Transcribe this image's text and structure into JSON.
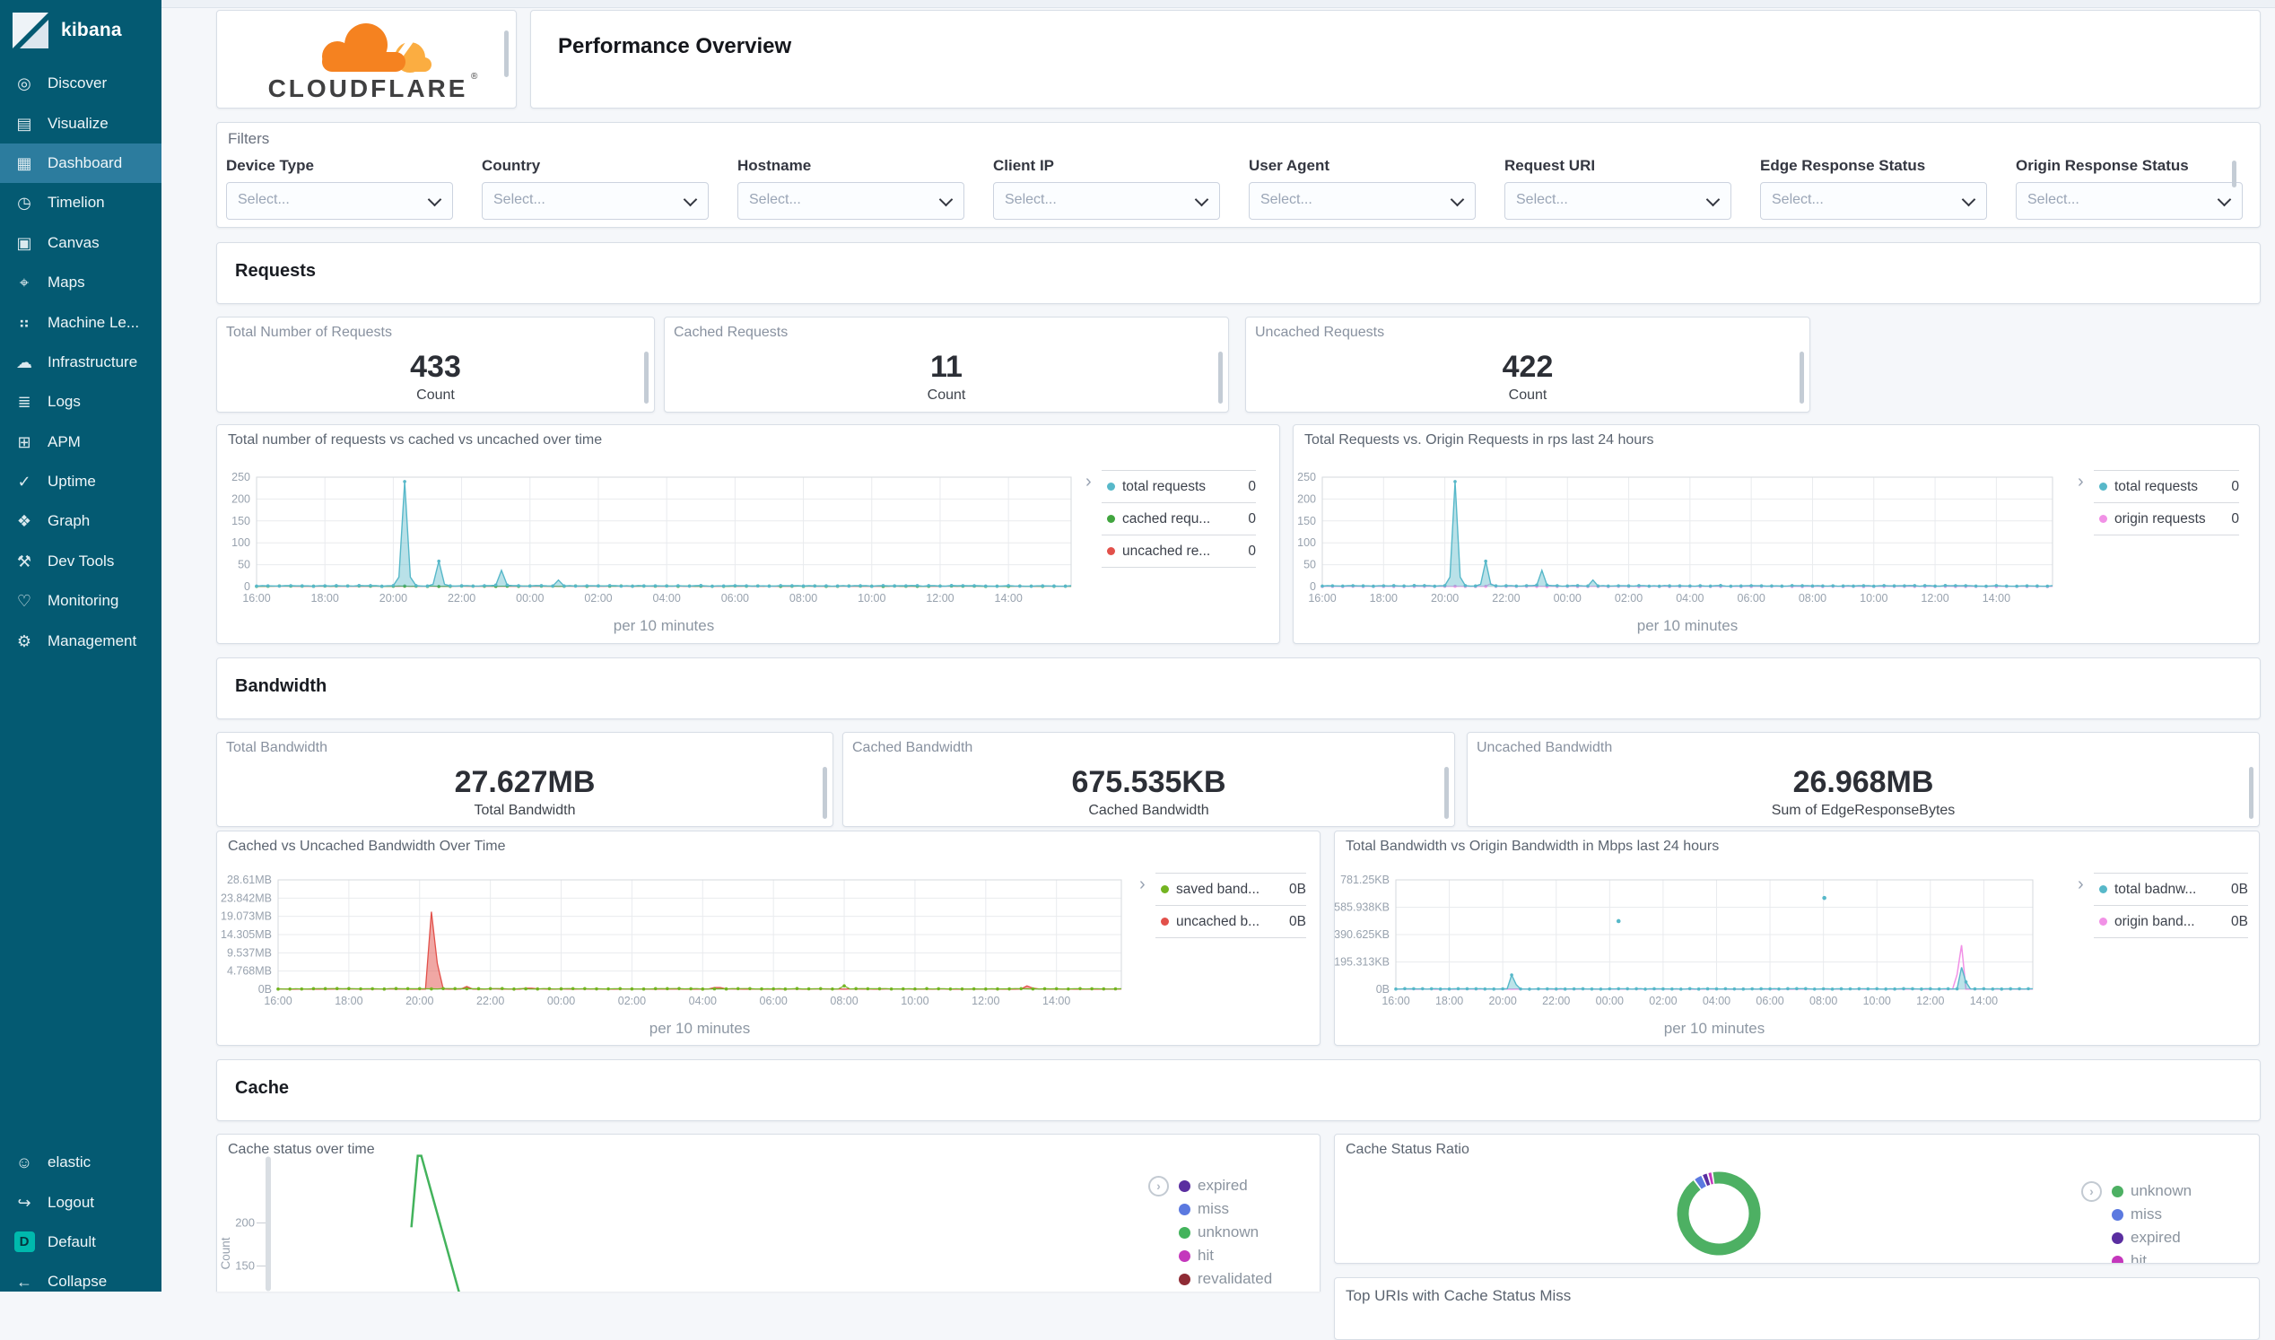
{
  "sidebar": {
    "logo_text": "kibana",
    "items": [
      {
        "label": "Discover",
        "icon": "◎"
      },
      {
        "label": "Visualize",
        "icon": "▤"
      },
      {
        "label": "Dashboard",
        "icon": "▦"
      },
      {
        "label": "Timelion",
        "icon": "◷"
      },
      {
        "label": "Canvas",
        "icon": "▣"
      },
      {
        "label": "Maps",
        "icon": "⌖"
      },
      {
        "label": "Machine Le...",
        "icon": "⠶"
      },
      {
        "label": "Infrastructure",
        "icon": "☁"
      },
      {
        "label": "Logs",
        "icon": "≣"
      },
      {
        "label": "APM",
        "icon": "⊞"
      },
      {
        "label": "Uptime",
        "icon": "✓"
      },
      {
        "label": "Graph",
        "icon": "❖"
      },
      {
        "label": "Dev Tools",
        "icon": "⚒"
      },
      {
        "label": "Monitoring",
        "icon": "♡"
      },
      {
        "label": "Management",
        "icon": "⚙"
      }
    ],
    "footer_items": [
      {
        "label": "elastic",
        "icon": "☺"
      },
      {
        "label": "Logout",
        "icon": "↪"
      },
      {
        "label": "Default",
        "icon": "D"
      },
      {
        "label": "Collapse",
        "icon": "←"
      }
    ]
  },
  "header": {
    "brand": "CLOUDFLARE",
    "registered": "®",
    "title": "Performance Overview"
  },
  "filters": {
    "title": "Filters",
    "placeholder": "Select...",
    "fields": [
      "Device Type",
      "Country",
      "Hostname",
      "Client IP",
      "User Agent",
      "Request URI",
      "Edge Response Status",
      "Origin Response Status"
    ]
  },
  "sections": {
    "requests": "Requests",
    "bandwidth": "Bandwidth",
    "cache": "Cache"
  },
  "metrics": {
    "requests": [
      {
        "label": "Total Number of Requests",
        "value": "433",
        "unit": "Count"
      },
      {
        "label": "Cached Requests",
        "value": "11",
        "unit": "Count"
      },
      {
        "label": "Uncached Requests",
        "value": "422",
        "unit": "Count"
      }
    ],
    "bandwidth": [
      {
        "label": "Total Bandwidth",
        "value": "27.627MB",
        "unit": "Total Bandwidth"
      },
      {
        "label": "Cached Bandwidth",
        "value": "675.535KB",
        "unit": "Cached Bandwidth"
      },
      {
        "label": "Uncached Bandwidth",
        "value": "26.968MB",
        "unit": "Sum of EdgeResponseBytes"
      }
    ]
  },
  "panels": {
    "top_uris_title": "Top URIs with Cache Status Miss"
  },
  "colors": {
    "sidebar_bg": "#045a72",
    "sidebar_active": "#2c7c9e",
    "accent_teal": "#00c2b2",
    "cloudflare_orange": "#f58220",
    "cloudflare_orange_light": "#fbad41",
    "series_teal": "#57b8c9",
    "series_green": "#41a53f",
    "series_red": "#e2504a",
    "series_pink": "#f191e6",
    "series_lime": "#73b421"
  },
  "chart_data": [
    {
      "type": "area",
      "title": "Total number of requests vs cached vs uncached over time",
      "x_label": "per 10 minutes",
      "x_ticks": [
        "16:00",
        "18:00",
        "20:00",
        "22:00",
        "00:00",
        "02:00",
        "04:00",
        "06:00",
        "08:00",
        "10:00",
        "12:00",
        "14:00"
      ],
      "y_ticks": [
        "250",
        "200",
        "150",
        "100",
        "50",
        "0"
      ],
      "y_max": 250,
      "series": [
        {
          "name": "total requests",
          "value": "0",
          "color": "#57b8c9",
          "fill": 0.42,
          "baseline": 2.2,
          "spikes": [
            [
              260,
              240
            ],
            [
              320,
              58
            ],
            [
              430,
              37
            ],
            [
              530,
              15
            ]
          ],
          "dots": true,
          "seed": 1
        },
        {
          "name": "cached requ...",
          "value": "0",
          "color": "#41a53f",
          "baseline": 1.4,
          "dots": true,
          "seed": 2,
          "width": 1
        },
        {
          "name": "uncached re...",
          "value": "0",
          "color": "#e2504a",
          "baseline": 0.9,
          "seed": 3,
          "width": 1
        }
      ]
    },
    {
      "type": "area",
      "title": "Total Requests vs. Origin Requests in rps last 24 hours",
      "x_label": "per 10 minutes",
      "x_ticks": [
        "16:00",
        "18:00",
        "20:00",
        "22:00",
        "00:00",
        "02:00",
        "04:00",
        "06:00",
        "08:00",
        "10:00",
        "12:00",
        "14:00"
      ],
      "y_ticks": [
        "250",
        "200",
        "150",
        "100",
        "50",
        "0"
      ],
      "y_max": 250,
      "series": [
        {
          "name": "total requests",
          "value": "0",
          "color": "#57b8c9",
          "fill": 0.42,
          "baseline": 2.2,
          "spikes": [
            [
              260,
              240
            ],
            [
              320,
              58
            ],
            [
              430,
              37
            ],
            [
              530,
              15
            ]
          ],
          "dots": true,
          "seed": 1
        },
        {
          "name": "origin requests",
          "value": "0",
          "color": "#f191e6",
          "baseline": 0.7,
          "spikes": [
            [
              330,
              7
            ]
          ],
          "dots": true,
          "seed": 4,
          "width": 1
        }
      ]
    },
    {
      "type": "area",
      "title": "Cached vs Uncached Bandwidth Over Time",
      "x_label": "per 10 minutes",
      "x_ticks": [
        "16:00",
        "18:00",
        "20:00",
        "22:00",
        "00:00",
        "02:00",
        "04:00",
        "06:00",
        "08:00",
        "10:00",
        "12:00",
        "14:00"
      ],
      "y_ticks": [
        "28.61MB",
        "23.842MB",
        "19.073MB",
        "14.305MB",
        "9.537MB",
        "4.768MB",
        "0B"
      ],
      "y_max": 28.61,
      "series": [
        {
          "name": "saved band...",
          "value": "0B",
          "color": "#73b421",
          "baseline": 0.18,
          "spikes": [
            [
              960,
              0.9
            ]
          ],
          "dots": true,
          "seed": 5,
          "width": 1.2
        },
        {
          "name": "uncached b...",
          "value": "0B",
          "color": "#e2504a",
          "fill": 0.5,
          "baseline": 0.1,
          "spikes": [
            [
              262,
              24.8
            ],
            [
              320,
              0.75
            ],
            [
              425,
              0.5
            ],
            [
              745,
              0.85
            ],
            [
              1272,
              1.1
            ]
          ],
          "seed": 6,
          "width": 1.3
        }
      ]
    },
    {
      "type": "area",
      "title": "Total Bandwidth vs Origin Bandwidth in Mbps last 24 hours",
      "x_label": "per 10 minutes",
      "x_ticks": [
        "16:00",
        "18:00",
        "20:00",
        "22:00",
        "00:00",
        "02:00",
        "04:00",
        "06:00",
        "08:00",
        "10:00",
        "12:00",
        "14:00"
      ],
      "y_ticks": [
        "781.25KB",
        "585.938KB",
        "390.625KB",
        "195.313KB",
        "0B"
      ],
      "y_max": 781.25,
      "series": [
        {
          "name": "total badnw...",
          "value": "0B",
          "color": "#57b8c9",
          "fill": 0.4,
          "baseline": 4,
          "spikes": [
            [
              262,
              125
            ],
            [
              1272,
              192
            ]
          ],
          "dots": true,
          "dots_extra": [
            [
              500,
              487
            ],
            [
              962,
              652
            ]
          ],
          "seed": 7
        },
        {
          "name": "origin band...",
          "value": "0B",
          "color": "#f191e6",
          "baseline": 2,
          "spikes": [
            [
              1268,
              385
            ]
          ],
          "seed": 8,
          "width": 1.5
        }
      ]
    },
    {
      "type": "line",
      "title": "Cache status over time",
      "y_label": "Count",
      "visible_y_ticks": [
        "200",
        "150"
      ],
      "series": [
        {
          "name": "expired",
          "color": "#5a2ea0"
        },
        {
          "name": "miss",
          "color": "#5b79e0"
        },
        {
          "name": "unknown",
          "color": "#43b35c"
        },
        {
          "name": "hit",
          "color": "#c437bc"
        },
        {
          "name": "revalidated",
          "color": "#8f2b35"
        }
      ],
      "unknown_spike_points": [
        [
          200,
          195
        ],
        [
          209,
          278
        ],
        [
          214,
          278
        ],
        [
          268,
          119
        ]
      ]
    },
    {
      "type": "pie",
      "title": "Cache Status Ratio",
      "slices": [
        {
          "label": "unknown",
          "pct": 92.5,
          "color": "#4db063"
        },
        {
          "label": "miss",
          "pct": 2.8,
          "color": "#5b79e0"
        },
        {
          "label": "expired",
          "pct": 1.6,
          "color": "#5a2ea0"
        },
        {
          "label": "hit",
          "pct": 1.1,
          "color": "#c437bc"
        }
      ]
    }
  ]
}
